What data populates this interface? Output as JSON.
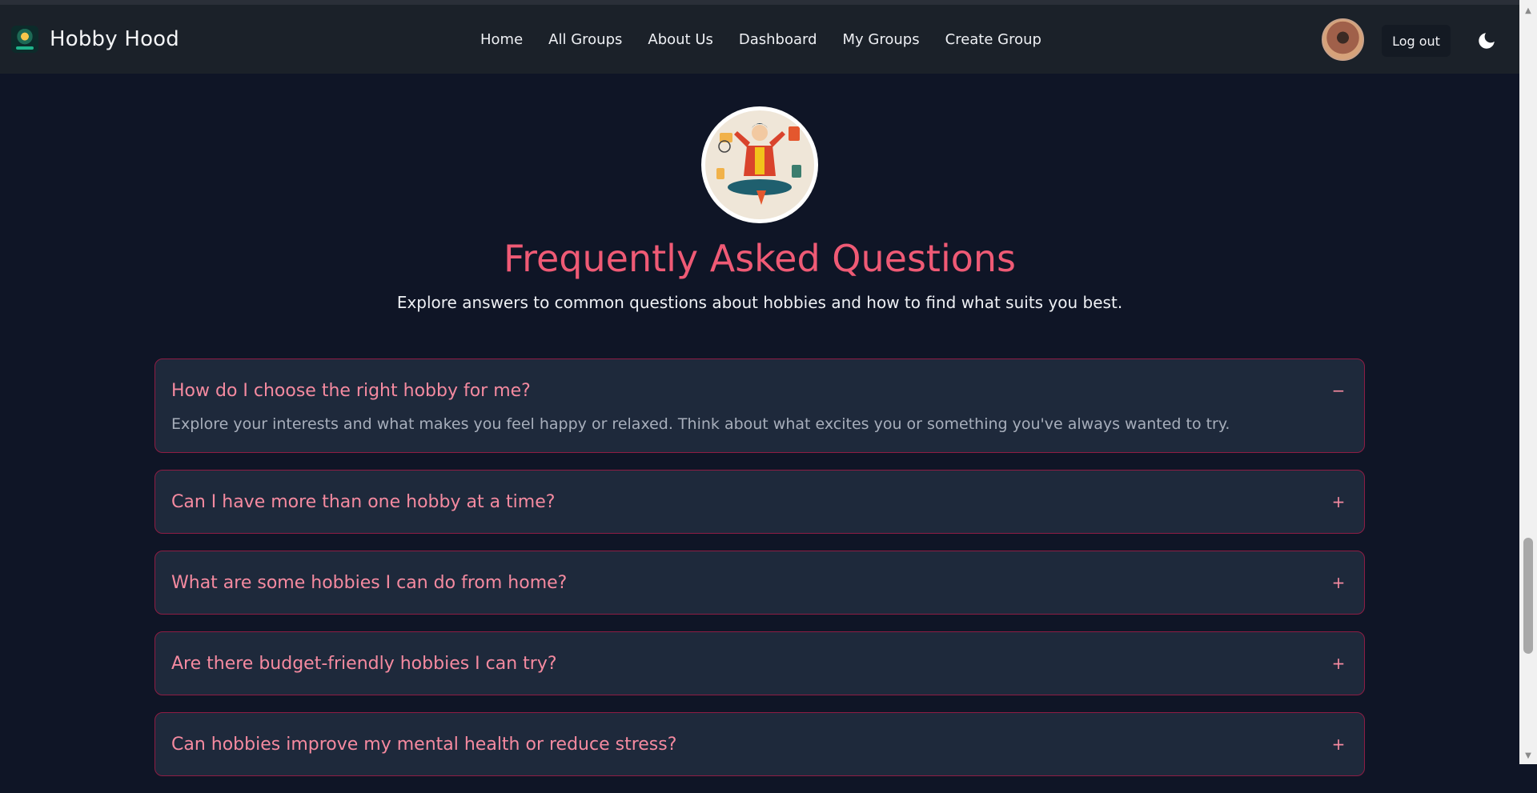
{
  "brand": {
    "name": "Hobby Hood"
  },
  "nav": {
    "links": [
      "Home",
      "All Groups",
      "About Us",
      "Dashboard",
      "My Groups",
      "Create Group"
    ]
  },
  "user": {
    "logout_label": "Log out"
  },
  "icons": {
    "logo": "hobby-hood-logo-icon",
    "theme": "moon-icon",
    "expanded": "minus-icon",
    "collapsed": "plus-icon"
  },
  "faq": {
    "title": "Frequently Asked Questions",
    "subtitle": "Explore answers to common questions about hobbies and how to find what suits you best.",
    "items": [
      {
        "question": "How do I choose the right hobby for me?",
        "answer": "Explore your interests and what makes you feel happy or relaxed. Think about what excites you or something you've always wanted to try.",
        "toggle": "−",
        "expanded": true
      },
      {
        "question": "Can I have more than one hobby at a time?",
        "toggle": "+",
        "expanded": false
      },
      {
        "question": "What are some hobbies I can do from home?",
        "toggle": "+",
        "expanded": false
      },
      {
        "question": "Are there budget-friendly hobbies I can try?",
        "toggle": "+",
        "expanded": false
      },
      {
        "question": "Can hobbies improve my mental health or reduce stress?",
        "toggle": "+",
        "expanded": false
      }
    ]
  },
  "colors": {
    "accent": "#ef5a75",
    "question": "#f58aa0",
    "card_bg": "#1e293b",
    "card_border": "#8e1d44",
    "page_bg": "#0f1526",
    "nav_bg": "#1b2129"
  }
}
